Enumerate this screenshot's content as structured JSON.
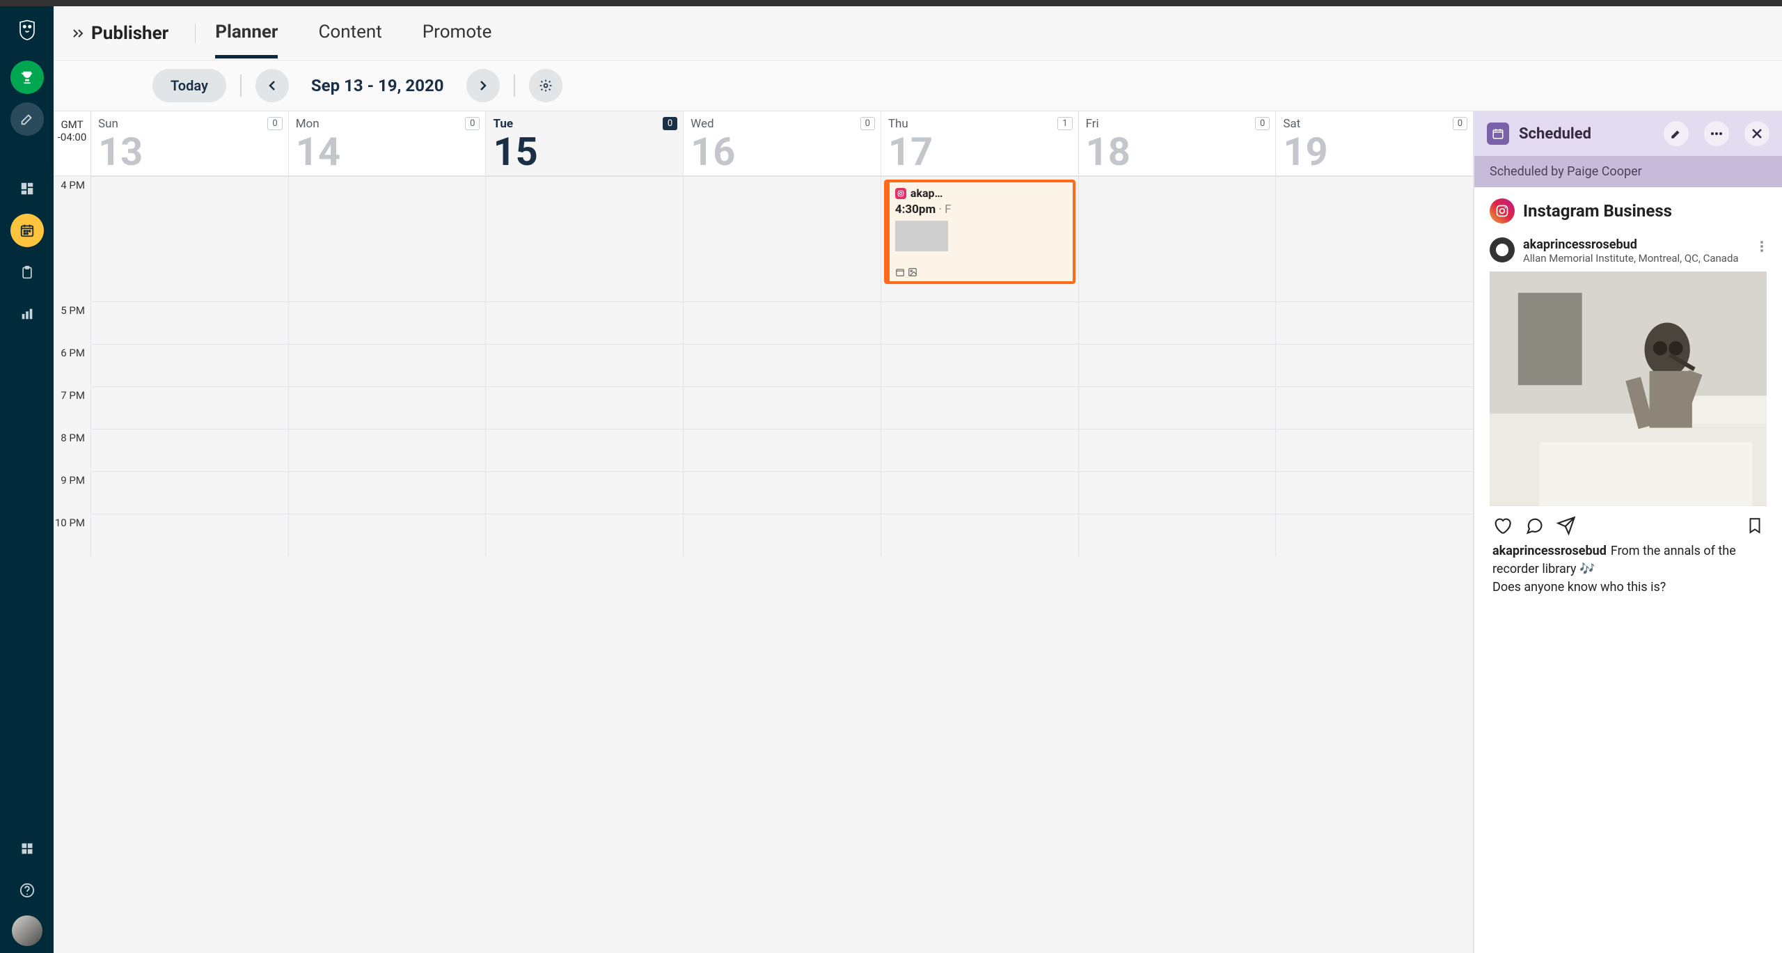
{
  "app": {
    "title": "Publisher"
  },
  "tabs": [
    {
      "id": "planner",
      "label": "Planner",
      "active": true
    },
    {
      "id": "content",
      "label": "Content",
      "active": false
    },
    {
      "id": "promote",
      "label": "Promote",
      "active": false
    }
  ],
  "toolbar": {
    "today_label": "Today",
    "date_range": "Sep 13 - 19, 2020"
  },
  "calendar": {
    "tz_label": "GMT",
    "tz_offset": "-04:00",
    "days": [
      {
        "abbr": "Sun",
        "num": "13",
        "count": "0",
        "today": false
      },
      {
        "abbr": "Mon",
        "num": "14",
        "count": "0",
        "today": false
      },
      {
        "abbr": "Tue",
        "num": "15",
        "count": "0",
        "today": true
      },
      {
        "abbr": "Wed",
        "num": "16",
        "count": "0",
        "today": false
      },
      {
        "abbr": "Thu",
        "num": "17",
        "count": "1",
        "today": false
      },
      {
        "abbr": "Fri",
        "num": "18",
        "count": "0",
        "today": false
      },
      {
        "abbr": "Sat",
        "num": "19",
        "count": "0",
        "today": false
      }
    ],
    "hours": [
      "4 PM",
      "5 PM",
      "6 PM",
      "7 PM",
      "8 PM",
      "9 PM",
      "10 PM"
    ],
    "event": {
      "day_index": 4,
      "account": "akap…",
      "time": "4:30pm",
      "snippet": "F"
    }
  },
  "panel": {
    "status": "Scheduled",
    "scheduled_by": "Scheduled by Paige Cooper",
    "network": "Instagram Business",
    "post": {
      "username": "akaprincessrosebud",
      "location": "Allan Memorial Institute, Montreal, QC, Canada",
      "caption_user": "akaprincessrosebud",
      "caption_line1": "From the annals of the recorder library 🎶",
      "caption_line2": "Does anyone know who this is?"
    }
  }
}
